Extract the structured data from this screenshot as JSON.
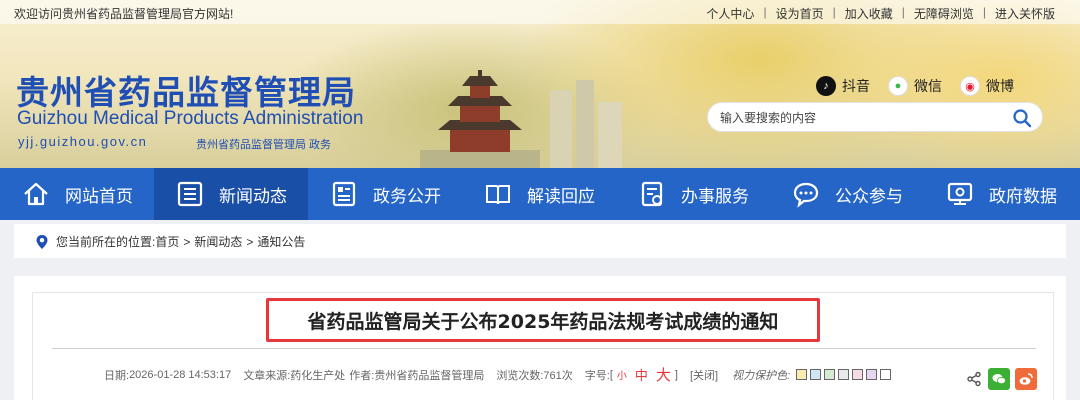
{
  "top": {
    "welcome": "欢迎访问贵州省药品监督管理局官方网站!",
    "links": [
      "个人中心",
      "设为首页",
      "加入收藏",
      "无障碍浏览",
      "进入关怀版"
    ]
  },
  "logo": {
    "cn": "贵州省药品监督管理局",
    "en": "Guizhou Medical Products Administration",
    "url": "yjj.guizhou.gov.cn",
    "sub": "贵州省药品监督管理局  政务"
  },
  "social": {
    "douyin": "抖音",
    "wechat": "微信",
    "weibo": "微博"
  },
  "search": {
    "placeholder": "输入要搜索的内容"
  },
  "nav": {
    "items": [
      {
        "label": "网站首页",
        "icon": "home-icon"
      },
      {
        "label": "新闻动态",
        "icon": "news-icon"
      },
      {
        "label": "政务公开",
        "icon": "document-icon"
      },
      {
        "label": "解读回应",
        "icon": "book-icon"
      },
      {
        "label": "办事服务",
        "icon": "service-icon"
      },
      {
        "label": "公众参与",
        "icon": "chat-icon"
      },
      {
        "label": "政府数据",
        "icon": "data-icon"
      }
    ],
    "active_index": 1
  },
  "breadcrumb": {
    "prefix": "您当前所在的位置:",
    "items": [
      "首页",
      "新闻动态",
      "通知公告"
    ]
  },
  "article": {
    "title": "省药品监管局关于公布2025年药品法规考试成绩的通知",
    "date_label": "日期:",
    "date": "2026-01-28 14:53:17",
    "source_label": "文章来源:",
    "source": "药化生产处",
    "author_label": "作者:",
    "author": "贵州省药品监督管理局",
    "views_label": "浏览次数:",
    "views": "761次",
    "fontsize_label": "字号:",
    "font_small": "小",
    "font_medium": "中",
    "font_large": "大",
    "bracket_open": "[",
    "bracket_close": "]",
    "close_label": "[关闭]",
    "eye_label": "视力保护色:",
    "swatches": [
      "#fbecb2",
      "#cfe6f4",
      "#d6ead2",
      "#e9e9e9",
      "#f7dbe4",
      "#e5d6f1",
      "#ffffff"
    ]
  }
}
